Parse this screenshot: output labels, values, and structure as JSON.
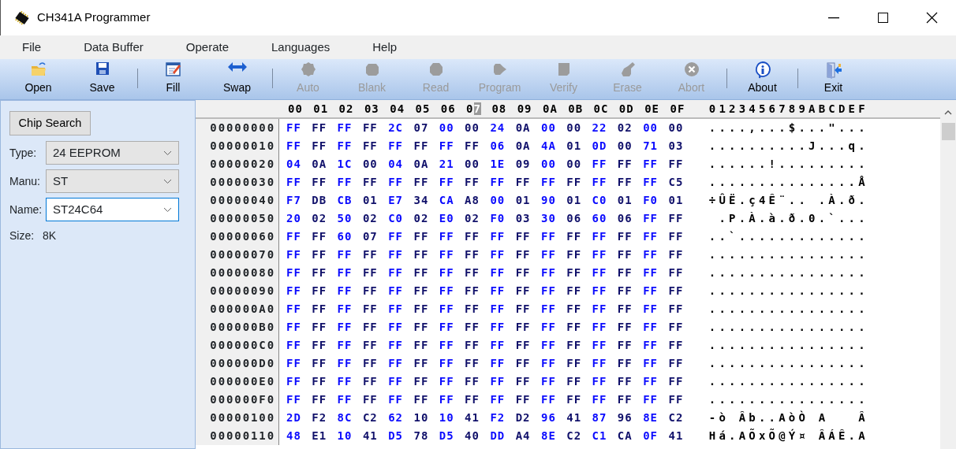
{
  "window": {
    "title": "CH341A Programmer"
  },
  "menu": [
    "File",
    "Data Buffer",
    "Operate",
    "Languages",
    "Help"
  ],
  "toolbar": [
    {
      "kind": "button",
      "label": "Open",
      "disabled": false
    },
    {
      "kind": "button",
      "label": "Save",
      "disabled": false
    },
    {
      "kind": "separator"
    },
    {
      "kind": "button",
      "label": "Fill",
      "disabled": false
    },
    {
      "kind": "button",
      "label": "Swap",
      "disabled": false
    },
    {
      "kind": "separator"
    },
    {
      "kind": "button",
      "label": "Auto",
      "disabled": true
    },
    {
      "kind": "button",
      "label": "Blank",
      "disabled": true
    },
    {
      "kind": "button",
      "label": "Read",
      "disabled": true
    },
    {
      "kind": "button",
      "label": "Program",
      "disabled": true
    },
    {
      "kind": "button",
      "label": "Verify",
      "disabled": true
    },
    {
      "kind": "button",
      "label": "Erase",
      "disabled": true
    },
    {
      "kind": "button",
      "label": "Abort",
      "disabled": true
    },
    {
      "kind": "separator"
    },
    {
      "kind": "button",
      "label": "About",
      "disabled": false
    },
    {
      "kind": "separator"
    },
    {
      "kind": "button",
      "label": "Exit",
      "disabled": false
    }
  ],
  "chip_panel": {
    "search_button": "Chip Search",
    "fields": [
      {
        "label": "Type:",
        "value": "24 EEPROM",
        "focused": false
      },
      {
        "label": "Manu:",
        "value": "ST",
        "focused": false
      },
      {
        "label": "Name:",
        "value": "ST24C64",
        "focused": true
      }
    ],
    "size": {
      "label": "Size:",
      "value": "8K"
    }
  },
  "hex_view": {
    "columns": [
      {
        "label": "00",
        "selected": false
      },
      {
        "label": "01",
        "selected": false
      },
      {
        "label": "02",
        "selected": false
      },
      {
        "label": "03",
        "selected": false
      },
      {
        "label": "04",
        "selected": false
      },
      {
        "label": "05",
        "selected": false
      },
      {
        "label": "06",
        "selected": false
      },
      {
        "label": "07",
        "selected": true
      },
      {
        "label": "08",
        "selected": false
      },
      {
        "label": "09",
        "selected": false
      },
      {
        "label": "0A",
        "selected": false
      },
      {
        "label": "0B",
        "selected": false
      },
      {
        "label": "0C",
        "selected": false
      },
      {
        "label": "0D",
        "selected": false
      },
      {
        "label": "0E",
        "selected": false
      },
      {
        "label": "0F",
        "selected": false
      }
    ],
    "ascii_header": "0123456789ABCDEF",
    "rows": [
      {
        "address": "00000000",
        "bytes": "FF FF FF FF 2C 07 00 00 24 0A 00 00 22 02 00 00",
        "ascii": "....,...$...\"..."
      },
      {
        "address": "00000010",
        "bytes": "FF FF FF FF FF FF FF FF 06 0A 4A 01 0D 00 71 03",
        "ascii": "..........J...q."
      },
      {
        "address": "00000020",
        "bytes": "04 0A 1C 00 04 0A 21 00 1E 09 00 00 FF FF FF FF",
        "ascii": "......!........."
      },
      {
        "address": "00000030",
        "bytes": "FF FF FF FF FF FF FF FF FF FF FF FF FF FF FF C5",
        "ascii": "...............Å"
      },
      {
        "address": "00000040",
        "bytes": "F7 DB CB 01 E7 34 CA A8 00 01 90 01 C0 01 F0 01",
        "ascii": "÷ÛË.ç4Ê¨.. .À.ð."
      },
      {
        "address": "00000050",
        "bytes": "20 02 50 02 C0 02 E0 02 F0 03 30 06 60 06 FF FF",
        "ascii": " .P.À.à.ð.0.`..."
      },
      {
        "address": "00000060",
        "bytes": "FF FF 60 07 FF FF FF FF FF FF FF FF FF FF FF FF",
        "ascii": "..`............."
      },
      {
        "address": "00000070",
        "bytes": "FF FF FF FF FF FF FF FF FF FF FF FF FF FF FF FF",
        "ascii": "................"
      },
      {
        "address": "00000080",
        "bytes": "FF FF FF FF FF FF FF FF FF FF FF FF FF FF FF FF",
        "ascii": "................"
      },
      {
        "address": "00000090",
        "bytes": "FF FF FF FF FF FF FF FF FF FF FF FF FF FF FF FF",
        "ascii": "................"
      },
      {
        "address": "000000A0",
        "bytes": "FF FF FF FF FF FF FF FF FF FF FF FF FF FF FF FF",
        "ascii": "................"
      },
      {
        "address": "000000B0",
        "bytes": "FF FF FF FF FF FF FF FF FF FF FF FF FF FF FF FF",
        "ascii": "................"
      },
      {
        "address": "000000C0",
        "bytes": "FF FF FF FF FF FF FF FF FF FF FF FF FF FF FF FF",
        "ascii": "................"
      },
      {
        "address": "000000D0",
        "bytes": "FF FF FF FF FF FF FF FF FF FF FF FF FF FF FF FF",
        "ascii": "................"
      },
      {
        "address": "000000E0",
        "bytes": "FF FF FF FF FF FF FF FF FF FF FF FF FF FF FF FF",
        "ascii": "................"
      },
      {
        "address": "000000F0",
        "bytes": "FF FF FF FF FF FF FF FF FF FF FF FF FF FF FF FF",
        "ascii": "................"
      },
      {
        "address": "00000100",
        "bytes": "2D F2 8C C2 62 10 10 41 F2 D2 96 41 87 96 8E C2",
        "ascii": "-ò Âb..AòÒ A   Â"
      },
      {
        "address": "00000110",
        "bytes": "48 E1 10 41 D5 78 D5 40 DD A4 8E C2 C1 CA 0F 41",
        "ascii": "Há.AÕxÕ@Ý¤ ÂÁÊ.A"
      }
    ]
  }
}
